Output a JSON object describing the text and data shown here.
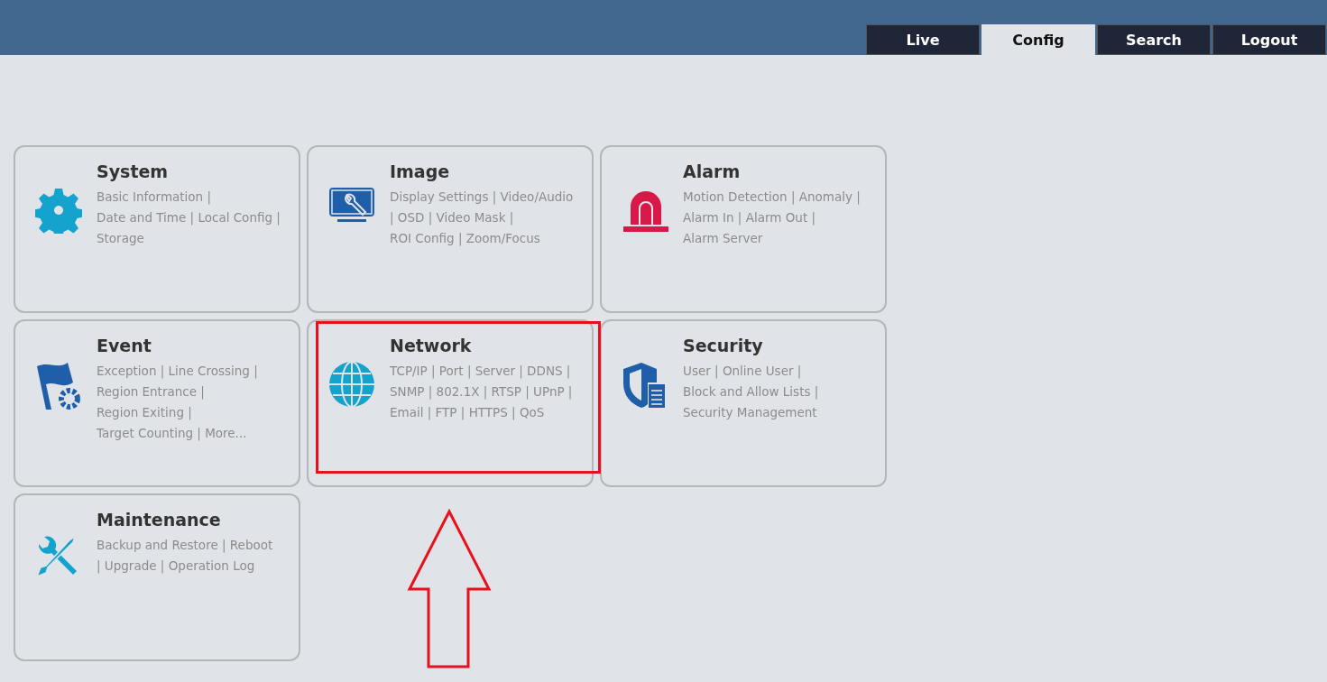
{
  "tabs": [
    {
      "label": "Live",
      "selected": false
    },
    {
      "label": "Config",
      "selected": true
    },
    {
      "label": "Search",
      "selected": false
    },
    {
      "label": "Logout",
      "selected": false
    }
  ],
  "cards": [
    {
      "title": "System",
      "kind": "gear",
      "lines": [
        "Basic Information |",
        "Date and Time | Local Config |",
        "Storage"
      ]
    },
    {
      "title": "Image",
      "kind": "monitor",
      "lines": [
        "Display Settings | Video/Audio",
        "| OSD | Video Mask |",
        "ROI Config | Zoom/Focus"
      ]
    },
    {
      "title": "Alarm",
      "kind": "alarm",
      "lines": [
        "Motion Detection | Anomaly |",
        "Alarm In | Alarm Out |",
        "Alarm Server"
      ]
    },
    {
      "title": "Event",
      "kind": "flag",
      "lines": [
        "Exception | Line Crossing |",
        "Region Entrance |",
        "Region Exiting |",
        "Target Counting | More..."
      ]
    },
    {
      "title": "Network",
      "kind": "globe",
      "lines": [
        "TCP/IP | Port | Server | DDNS |",
        "SNMP | 802.1X | RTSP | UPnP |",
        "Email | FTP | HTTPS | QoS"
      ]
    },
    {
      "title": "Security",
      "kind": "shield",
      "lines": [
        "User | Online User |",
        "Block and Allow Lists |",
        "Security Management"
      ]
    },
    {
      "title": "Maintenance",
      "kind": "tools",
      "lines": [
        "Backup and Restore  | Reboot",
        "| Upgrade | Operation Log"
      ]
    }
  ],
  "annotation": {
    "highlight": true,
    "arrow": true
  }
}
